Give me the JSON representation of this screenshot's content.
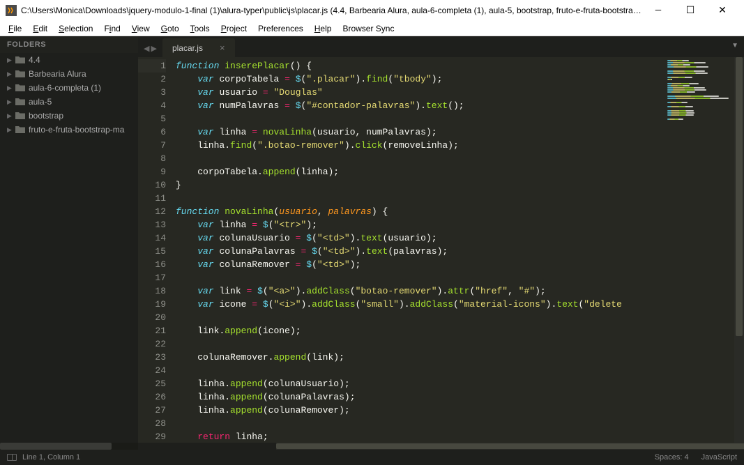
{
  "titlebar": {
    "path": "C:\\Users\\Monica\\Downloads\\jquery-modulo-1-final (1)\\alura-typer\\public\\js\\placar.js (4.4, Barbearia Alura, aula-6-completa (1), aula-5, bootstrap, fruto-e-fruta-bootstra…"
  },
  "menu": {
    "items": [
      {
        "label": "File",
        "u": 0
      },
      {
        "label": "Edit",
        "u": 0
      },
      {
        "label": "Selection",
        "u": 0
      },
      {
        "label": "Find",
        "u": 1
      },
      {
        "label": "View",
        "u": 0
      },
      {
        "label": "Goto",
        "u": 0
      },
      {
        "label": "Tools",
        "u": 0
      },
      {
        "label": "Project",
        "u": 0
      },
      {
        "label": "Preferences",
        "u": -1
      },
      {
        "label": "Help",
        "u": 0
      },
      {
        "label": "Browser Sync",
        "u": -1
      }
    ]
  },
  "sidebar": {
    "header": "FOLDERS",
    "folders": [
      {
        "name": "4.4"
      },
      {
        "name": "Barbearia Alura"
      },
      {
        "name": "aula-6-completa (1)"
      },
      {
        "name": "aula-5"
      },
      {
        "name": "bootstrap"
      },
      {
        "name": "fruto-e-fruta-bootstrap-ma"
      }
    ]
  },
  "tabs": {
    "active": "placar.js"
  },
  "editor": {
    "first_line": 1,
    "last_line": 29,
    "lines": [
      "function inserePlacar() {",
      "    var corpoTabela = $(\".placar\").find(\"tbody\");",
      "    var usuario = \"Douglas\"",
      "    var numPalavras = $(\"#contador-palavras\").text();",
      "",
      "    var linha = novaLinha(usuario, numPalavras);",
      "    linha.find(\".botao-remover\").click(removeLinha);",
      "",
      "    corpoTabela.append(linha);",
      "}",
      "",
      "function novaLinha(usuario, palavras) {",
      "    var linha = $(\"<tr>\");",
      "    var colunaUsuario = $(\"<td>\").text(usuario);",
      "    var colunaPalavras = $(\"<td>\").text(palavras);",
      "    var colunaRemover = $(\"<td>\");",
      "",
      "    var link = $(\"<a>\").addClass(\"botao-remover\").attr(\"href\", \"#\");",
      "    var icone = $(\"<i>\").addClass(\"small\").addClass(\"material-icons\").text(\"delete",
      "",
      "    link.append(icone);",
      "",
      "    colunaRemover.append(link);",
      "",
      "    linha.append(colunaUsuario);",
      "    linha.append(colunaPalavras);",
      "    linha.append(colunaRemover);",
      "",
      "    return linha;"
    ]
  },
  "statusbar": {
    "position": "Line 1, Column 1",
    "spaces": "Spaces: 4",
    "language": "JavaScript"
  }
}
